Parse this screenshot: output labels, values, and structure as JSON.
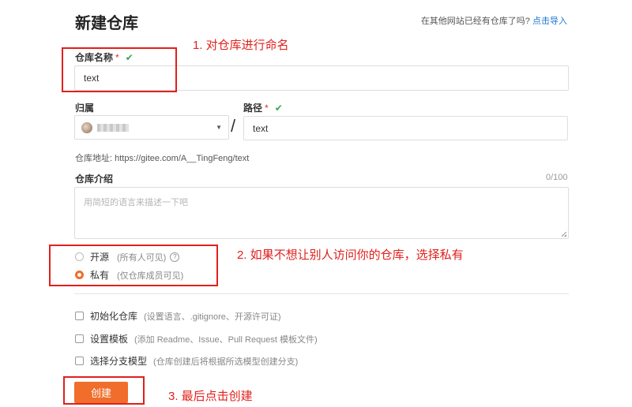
{
  "page": {
    "title": "新建仓库",
    "import_hint": "在其他网站已经有仓库了吗?",
    "import_link": "点击导入"
  },
  "form": {
    "repo_name_label": "仓库名称",
    "required_mark": "*",
    "check_mark": "✔",
    "repo_name_value": "text",
    "owner_label": "归属",
    "separator": "/",
    "path_label": "路径",
    "path_value": "text",
    "repo_address_label": "仓库地址:",
    "repo_address": "https://gitee.com/A__TingFeng/text",
    "intro_label": "仓库介绍",
    "intro_counter": "0/100",
    "intro_placeholder": "用简短的语言来描述一下吧",
    "visibility": {
      "public_label": "开源",
      "public_hint": "(所有人可见)",
      "help_icon_glyph": "?",
      "private_label": "私有",
      "private_hint": "(仅仓库成员可见)",
      "selected": "private"
    },
    "options": [
      {
        "label": "初始化仓库",
        "hint": "(设置语言、.gitignore、开源许可证)"
      },
      {
        "label": "设置模板",
        "hint": "(添加 Readme、Issue、Pull Request 模板文件)"
      },
      {
        "label": "选择分支模型",
        "hint": "(仓库创建后将根据所选模型创建分支)"
      }
    ],
    "submit_label": "创建"
  },
  "annotations": {
    "step1": "1. 对仓库进行命名",
    "step2": "2. 如果不想让别人访问你的仓库，选择私有",
    "step3": "3. 最后点击创建",
    "color": "#e0201c"
  },
  "colors": {
    "accent": "#f06d2b",
    "link": "#1b76d1",
    "check": "#35a94b"
  }
}
